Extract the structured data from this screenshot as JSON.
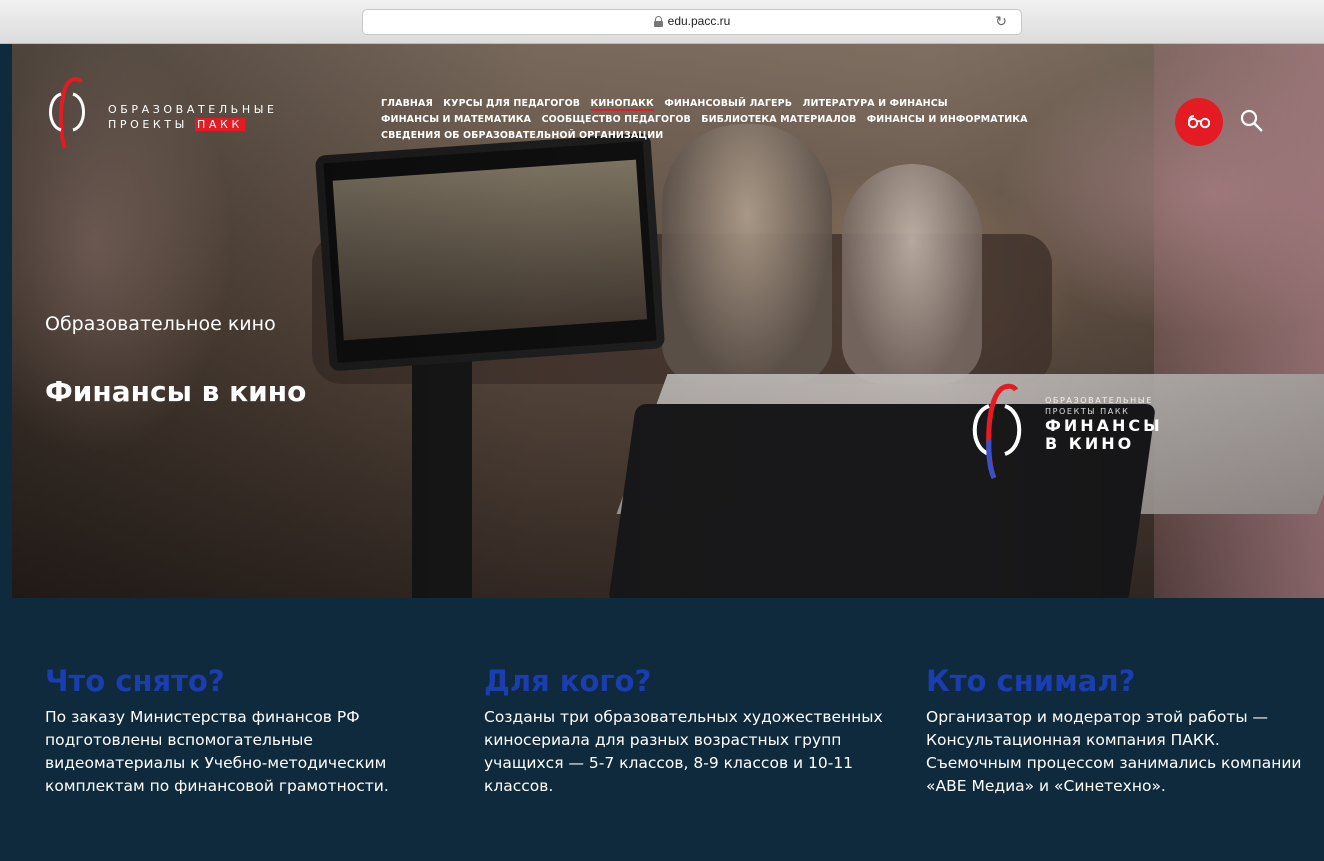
{
  "browser": {
    "url": "edu.pacc.ru"
  },
  "logo": {
    "line1": "ОБРАЗОВАТЕЛЬНЫЕ",
    "line2_prefix": "ПРОЕКТЫ ",
    "line2_highlight": "ПАКК"
  },
  "nav": {
    "items": [
      "ГЛАВНАЯ",
      "КУРСЫ ДЛЯ ПЕДАГОГОВ",
      "КИНОПАКК",
      "ФИНАНСОВЫЙ ЛАГЕРЬ",
      "ЛИТЕРАТУРА И ФИНАНСЫ",
      "ФИНАНСЫ И МАТЕМАТИКА",
      "СООБЩЕСТВО ПЕДАГОГОВ",
      "БИБЛИОТЕКА МАТЕРИАЛОВ",
      "ФИНАНСЫ И ИНФОРМАТИКА",
      "СВЕДЕНИЯ ОБ ОБРАЗОВАТЕЛЬНОЙ ОРГАНИЗАЦИИ"
    ],
    "active": "КИНОПАКК"
  },
  "icons": {
    "accessibility": "glasses-icon",
    "search": "search-icon",
    "accent_color": "#e51b24"
  },
  "hero": {
    "subtitle": "Образовательное кино",
    "title": "Финансы в кино"
  },
  "film_logo": {
    "small1": "ОБРАЗОВАТЕЛЬНЫЕ",
    "small2": "ПРОЕКТЫ ПАКК",
    "big1": "ФИНАНСЫ",
    "big2": "В КИНО"
  },
  "info": {
    "columns": [
      {
        "heading": "Что снято?",
        "text": "По заказу Министерства финансов РФ подготовлены вспомогательные видеоматериалы к Учебно-методическим комплектам по финансовой грамотности."
      },
      {
        "heading": "Для кого?",
        "text": "Созданы три образовательных художественных киносериала для разных возрастных групп учащихся — 5-7 классов, 8-9 классов и 10-11 классов."
      },
      {
        "heading": "Кто снимал?",
        "text": "Организатор и модератор этой работы — Консультационная компания ПАКК. Съемочным процессом занимались компании «АВЕ Медиа» и «Синетехно»."
      }
    ],
    "heading_color": "#1b3db0",
    "background_color": "#0e2a3c"
  }
}
